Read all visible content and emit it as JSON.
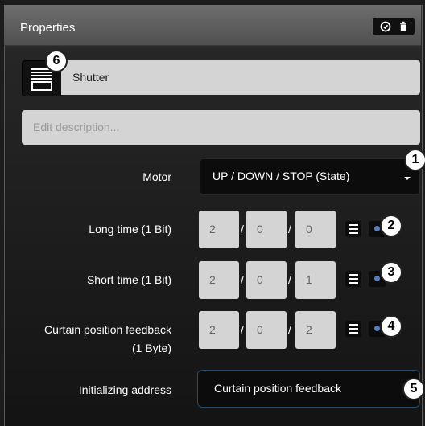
{
  "panel": {
    "title": "Properties"
  },
  "device": {
    "name": "Shutter",
    "description_placeholder": "Edit description..."
  },
  "motor": {
    "label": "Motor",
    "value": "UP / DOWN / STOP (State)"
  },
  "rows": [
    {
      "label": "Long time (1 Bit)",
      "address": [
        "2",
        "0",
        "0"
      ]
    },
    {
      "label": "Short time (1 Bit)",
      "address": [
        "2",
        "0",
        "1"
      ]
    },
    {
      "label_line1": "Curtain position feedback",
      "label_line2": "(1 Byte)",
      "address": [
        "2",
        "0",
        "2"
      ]
    }
  ],
  "separator": "/",
  "init": {
    "label": "Initializing address",
    "value": "Curtain position feedback"
  },
  "badges": [
    "1",
    "2",
    "3",
    "4",
    "5",
    "6"
  ],
  "icons": {
    "header": [
      "check-circle-icon",
      "trash-icon"
    ],
    "device_type": "shutter-icon",
    "list": "list-icon"
  }
}
